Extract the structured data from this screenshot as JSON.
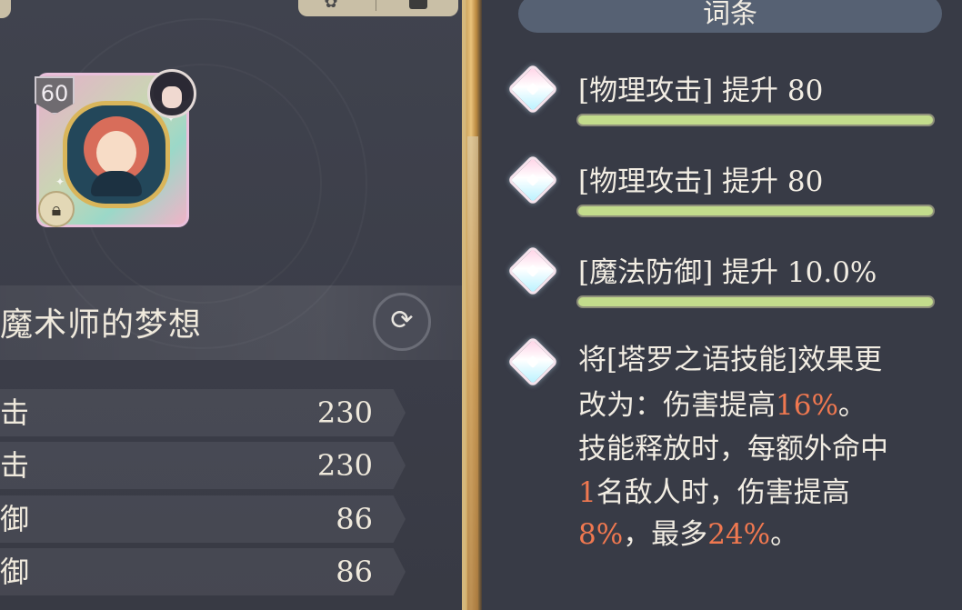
{
  "item": {
    "level": "60",
    "name": "魔术师的梦想"
  },
  "stats": [
    {
      "label": "击",
      "value": "230"
    },
    {
      "label": "击",
      "value": "230"
    },
    {
      "label": "御",
      "value": "86"
    },
    {
      "label": "御",
      "value": "86"
    }
  ],
  "affix_panel": {
    "title": "词条",
    "attributes": [
      {
        "text": "[物理攻击] 提升 80"
      },
      {
        "text": "[物理攻击] 提升 80"
      },
      {
        "text": "[魔法防御] 提升 10.0%"
      }
    ],
    "effect_lines": [
      [
        "将[塔罗之语技能]效果更"
      ],
      [
        "改为：伤害提高",
        "16%",
        "。"
      ],
      [
        "技能释放时，每额外命中"
      ],
      [
        "1",
        "名敌人时，伤害提高"
      ],
      [
        "8%",
        "，最多",
        "24%",
        "。"
      ]
    ]
  },
  "icons": {
    "lock": "lock-icon",
    "swap": "swap-icon",
    "gem": "diamond-gem-icon"
  },
  "colors": {
    "highlight": "#f07850",
    "attr_bar": "#c3dc8c",
    "text": "#f2ede3",
    "header": "#566173"
  }
}
